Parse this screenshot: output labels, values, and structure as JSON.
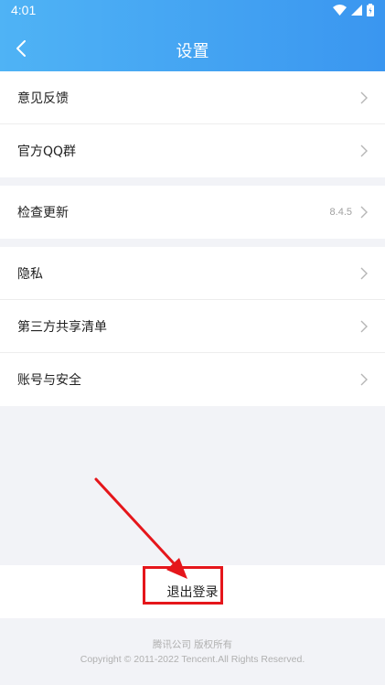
{
  "status_bar": {
    "time": "4:01"
  },
  "header": {
    "title": "设置",
    "back_icon": "chevron-left-icon"
  },
  "groups": [
    {
      "items": [
        {
          "label": "意见反馈",
          "value": ""
        },
        {
          "label": "官方QQ群",
          "value": ""
        }
      ]
    },
    {
      "items": [
        {
          "label": "检查更新",
          "value": "8.4.5"
        }
      ]
    },
    {
      "items": [
        {
          "label": "隐私",
          "value": ""
        },
        {
          "label": "第三方共享清单",
          "value": ""
        },
        {
          "label": "账号与安全",
          "value": ""
        }
      ]
    }
  ],
  "logout": {
    "label": "退出登录"
  },
  "footer": {
    "company": "腾讯公司 版权所有",
    "copyright": "Copyright © 2011-2022 Tencent.All Rights Reserved."
  },
  "colors": {
    "header_start": "#4fb3f5",
    "header_end": "#3a96f0",
    "annotation": "#e5161b",
    "background": "#f2f3f7"
  }
}
